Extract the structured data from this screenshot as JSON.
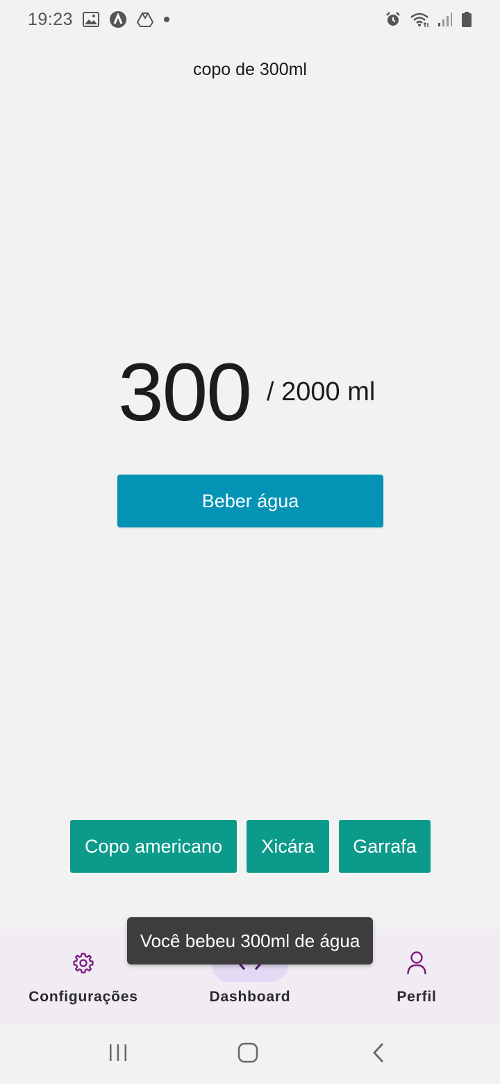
{
  "status_bar": {
    "time": "19:23",
    "left_icons": [
      "image-icon",
      "app-a-icon",
      "drive-icon",
      "dot-icon"
    ],
    "right_icons": [
      "alarm-icon",
      "wifi-icon",
      "signal-icon",
      "battery-icon"
    ]
  },
  "main": {
    "glass_label": "copo de 300ml",
    "current_amount": "300",
    "goal_text": "/ 2000 ml",
    "drink_button_label": "Beber água"
  },
  "size_options": [
    {
      "label": "Copo americano"
    },
    {
      "label": "Xicára"
    },
    {
      "label": "Garrafa"
    }
  ],
  "toast": {
    "message": "Você bebeu 300ml de água"
  },
  "bottom_nav": {
    "items": [
      {
        "label": "Configurações",
        "icon": "gear-icon",
        "active": false
      },
      {
        "label": "Dashboard",
        "icon": "code-brackets-icon",
        "active": true
      },
      {
        "label": "Perfil",
        "icon": "person-icon",
        "active": false
      }
    ]
  },
  "colors": {
    "background": "#f2f2f2",
    "primary_button": "#0492b5",
    "option_button": "#0c9a8a",
    "nav_background": "#f1ebf3",
    "nav_active_pill": "#e3d9f3",
    "nav_icon": "#7b1a7f",
    "toast": "#3d3d3d"
  }
}
